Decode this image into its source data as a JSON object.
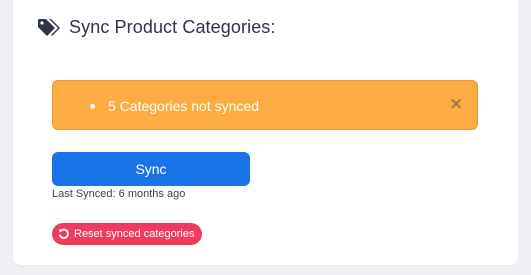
{
  "section": {
    "title": "Sync Product Categories:",
    "title_icon": "tags-icon"
  },
  "alert": {
    "color": "#fdab43",
    "items": [
      "5 Categories not synced"
    ],
    "close_glyph": "×"
  },
  "sync": {
    "button_label": "Sync",
    "button_color": "#1a74e8",
    "last_synced": "Last Synced: 6 months ago"
  },
  "reset": {
    "button_label": "Reset synced categories",
    "button_color": "#ef3b5d",
    "icon": "undo-icon"
  }
}
